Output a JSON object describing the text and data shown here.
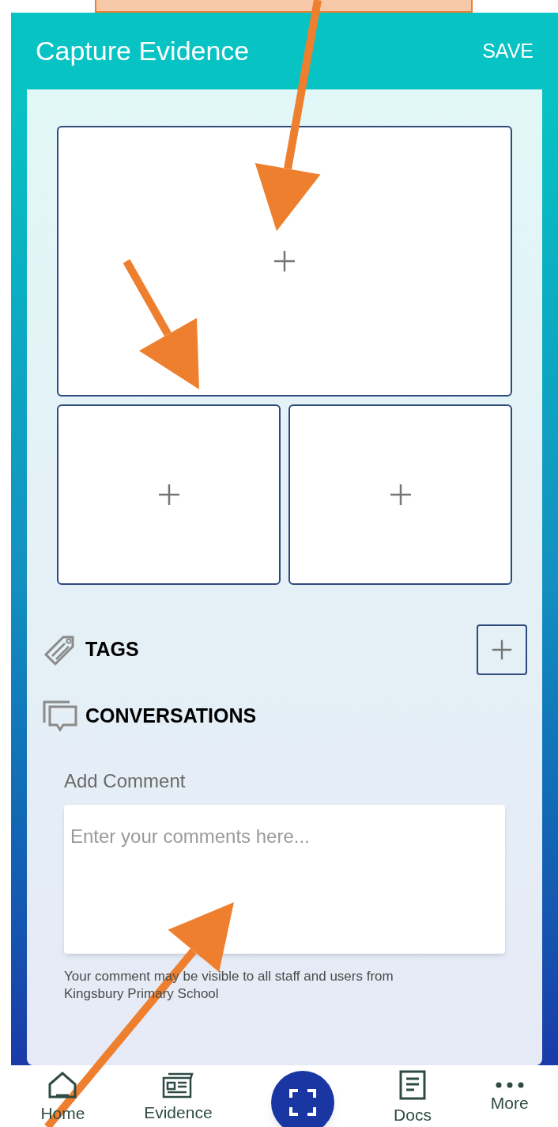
{
  "header": {
    "title": "Capture Evidence",
    "action": "SAVE"
  },
  "media_slots": [
    {
      "kind": "large"
    },
    {
      "kind": "small"
    },
    {
      "kind": "small"
    }
  ],
  "tags": {
    "title": "TAGS"
  },
  "conversations": {
    "title": "CONVERSATIONS",
    "comment_label": "Add Comment",
    "placeholder": "Enter your comments here...",
    "note": "Your comment may be visible to all staff and users from Kingsbury Primary School"
  },
  "nav": [
    {
      "label": "Home",
      "kind": "home"
    },
    {
      "label": "Evidence",
      "kind": "evidence"
    },
    {
      "kind": "scan"
    },
    {
      "label": "Docs",
      "kind": "docs"
    },
    {
      "label": "More",
      "kind": "more"
    }
  ]
}
